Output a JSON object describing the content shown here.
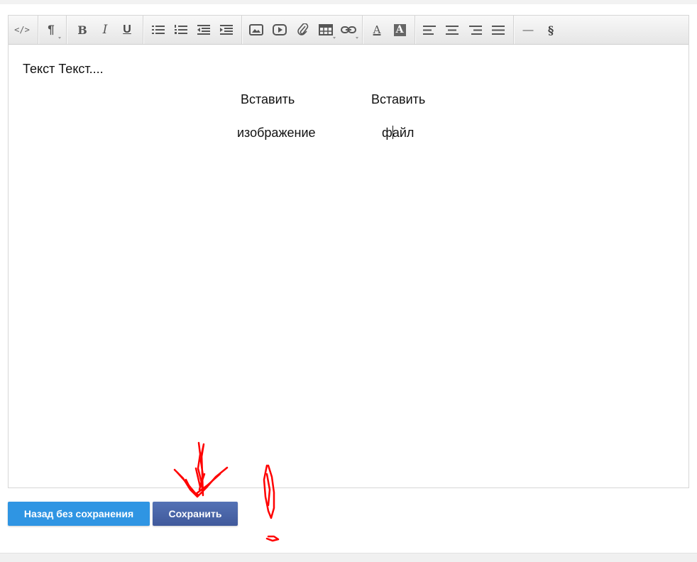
{
  "editor": {
    "toolbar": {
      "items": [
        {
          "name": "html-code-icon",
          "glyph": "</>"
        },
        {
          "name": "paragraph-format-icon",
          "glyph": "¶"
        },
        {
          "name": "bold-icon",
          "glyph": "B"
        },
        {
          "name": "italic-icon",
          "glyph": "I"
        },
        {
          "name": "underline-icon",
          "glyph": "U"
        },
        {
          "name": "unordered-list-icon"
        },
        {
          "name": "ordered-list-icon"
        },
        {
          "name": "outdent-icon"
        },
        {
          "name": "indent-icon"
        },
        {
          "name": "image-icon"
        },
        {
          "name": "video-icon"
        },
        {
          "name": "attachment-icon"
        },
        {
          "name": "table-icon"
        },
        {
          "name": "link-icon"
        },
        {
          "name": "font-color-icon",
          "glyph": "A"
        },
        {
          "name": "background-color-icon",
          "glyph": "A"
        },
        {
          "name": "align-left-icon"
        },
        {
          "name": "align-center-icon"
        },
        {
          "name": "align-right-icon"
        },
        {
          "name": "justify-icon"
        },
        {
          "name": "horizontal-rule-icon",
          "glyph": "—"
        },
        {
          "name": "section-sign-icon",
          "glyph": "§"
        }
      ]
    },
    "content": {
      "paragraph": "Текст Текст....",
      "insert_image_line1": "Вставить",
      "insert_image_line2": "изображение",
      "insert_file_line1": "Вставить",
      "insert_file_line2_a": "ф",
      "insert_file_line2_b": "айл"
    }
  },
  "buttons": {
    "back_label": "Назад без сохранения",
    "save_label": "Сохранить"
  },
  "colors": {
    "back_button": "#2f95e3",
    "save_button": "#4a64a8",
    "annotation": "#ff0000"
  }
}
